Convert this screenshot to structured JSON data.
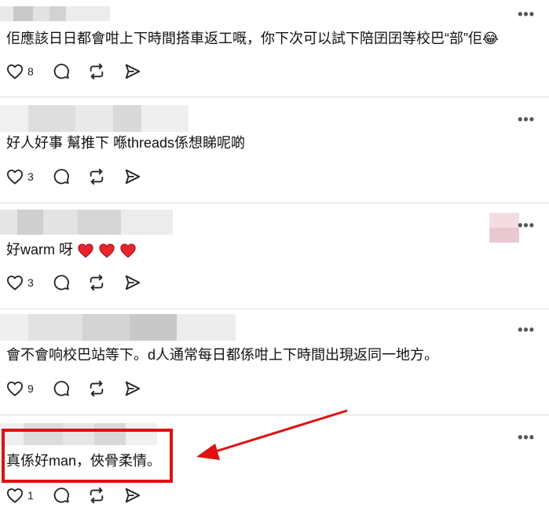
{
  "comments": [
    {
      "text": "佢應該日日都會咁上下時間搭車返工嘅，你下次可以試下陪囝囝等校巴“部”佢😂",
      "likes": "8"
    },
    {
      "text": "好人好事 幫推下 喺threads係想睇呢啲",
      "likes": "3"
    },
    {
      "text": "好warm 呀",
      "likes": "3"
    },
    {
      "text": "會不會响校巴站等下。d人通常每日都係咁上下時間出現返同一地方。",
      "likes": "9"
    },
    {
      "text": "真係好man，俠骨柔情。",
      "likes": "1"
    }
  ],
  "more_glyph": "•••",
  "icons": [
    "heart-icon",
    "comment-icon",
    "repost-icon",
    "share-icon",
    "more-icon"
  ],
  "annotation": {
    "highlight_color": "#e01010",
    "arrow_color": "#e01010"
  }
}
